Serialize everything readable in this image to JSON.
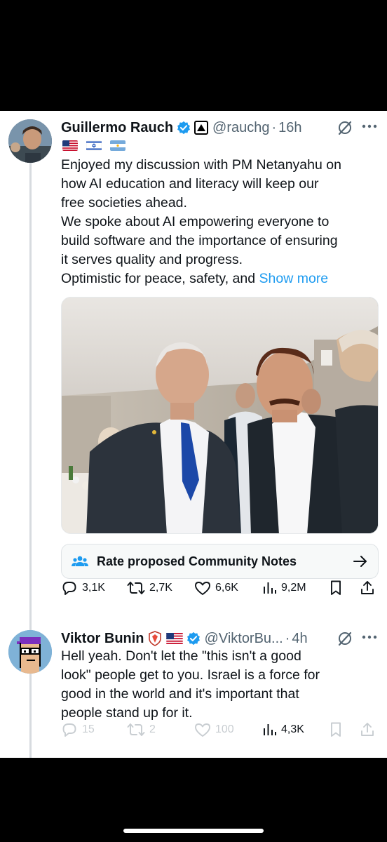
{
  "tweet": {
    "author_name": "Guillermo Rauch",
    "handle": "@rauchg",
    "time": "16h",
    "flags": [
      "us-flag",
      "israel-flag",
      "argentina-flag"
    ],
    "text_lines": [
      "Enjoyed my discussion with PM Netanyahu on",
      "how AI education and literacy will keep our",
      "free societies ahead.",
      "We spoke about AI empowering everyone to",
      "build software and the importance of ensuring",
      "it serves quality and progress."
    ],
    "last_line": "Optimistic for peace, safety, and",
    "show_more": "Show more",
    "community_notes": "Rate proposed Community Notes",
    "stats": {
      "replies": "3,1K",
      "reposts": "2,7K",
      "likes": "6,6K",
      "views": "9,2M"
    }
  },
  "reply": {
    "author_name": "Viktor Bunin",
    "handle": "@ViktorBu...",
    "time": "4h",
    "text_lines": [
      "Hell yeah. Don't let the \"this isn't a good",
      "look\" people get to you. Israel is a force for",
      "good in the world and it's important that",
      "people stand up for it."
    ],
    "stats": {
      "replies": "15",
      "reposts": "2",
      "likes": "100",
      "views": "4,3K"
    }
  },
  "colors": {
    "accent": "#1d9bf0",
    "text": "#0f1419",
    "secondary": "#536471",
    "background": "#ffffff"
  }
}
